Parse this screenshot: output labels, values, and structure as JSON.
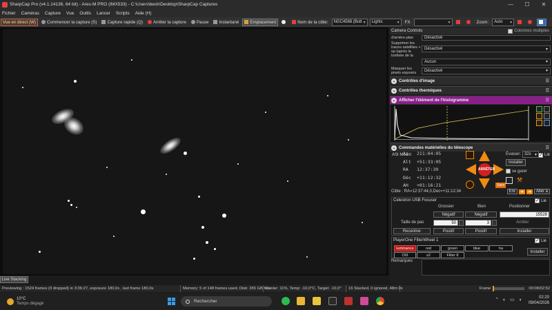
{
  "window": {
    "title": "SharpCap Pro (v4.1.14136, 64 bit) - Ares-M PRO (IMX533) - C:\\Users\\beck\\Desktop\\SharpCap Captures",
    "controls": {
      "minimize": "—",
      "maximize": "☐",
      "close": "✕"
    }
  },
  "menu": [
    "Fichier",
    "Caméras",
    "Capture",
    "Vue",
    "Outils",
    "Lancer",
    "Scripts",
    "Aide (H)"
  ],
  "toolbar": {
    "live_view": "Vue en direct (W)",
    "start_capture": "Commencer la capture (S)",
    "quick_capture": "Capture rapide (Q)",
    "stop_capture": "Arrêter la capture",
    "pause": "Pause",
    "snapshot": "Instantané",
    "placement": "Emplacement",
    "target_label": "Nom de la cible:",
    "target_value": "NGC4568 (Butt",
    "frame_type": "Lights",
    "fx_label": "FX",
    "fx_value": "",
    "zoom_label": "Zoom:",
    "zoom_value": "Auto"
  },
  "live_stacking_tab": "Live Stacking",
  "status": {
    "previewing": "Previewing : 1524 frames (0 dropped) in 3:36:27, exposure 180,0s , last frame 180,0s",
    "memory": "Memory: 5 of 148 frames used, Disk: 265 GB free",
    "cooler": "Cooler: 11%, Temp: -10,0°C, Target: -10,0°",
    "stack": "16 Stacked, 0 ignored, 48m 0s",
    "frame_label": "Frame",
    "time": "00:08/02:52"
  },
  "side": {
    "header_title": "Camera Controls",
    "header_checkbox": "Colonnes multiples",
    "controls": [
      {
        "label": "d'arrière-plan",
        "value": "Désactivé"
      },
      {
        "label": "Supprimer les traces satellites + sp (après la tombée de la nuit) sites",
        "value": "Désactivé"
      },
      {
        "label": "",
        "value": "Aucun"
      },
      {
        "label": "Masquer les pixels exposés",
        "value": "Désactivé"
      }
    ],
    "sections": {
      "image_controls": "Contrôles d'image",
      "thermal_controls": "Contrôles thermiques",
      "histogram": "Afficher l'élément de l'histogramme",
      "telescope": "Commandes matérielles du télescope"
    },
    "mount": {
      "name": "ASI Mount",
      "lie_label": "Lié",
      "coords": [
        {
          "k": "Az",
          "v": "211:04:05"
        },
        {
          "k": "Alt",
          "v": "+51:33:05"
        },
        {
          "k": "RA",
          "v": "12:37:39"
        },
        {
          "k": "Déc",
          "v": "+11:12:32"
        },
        {
          "k": "AH",
          "v": "+01:16:21"
        }
      ],
      "stop": "ARRÊTER",
      "follow": "Suivi",
      "evaluate_label": "Évaluer:",
      "evaluate_value": "32x",
      "install": "Installer",
      "park": "se garer",
      "target_line": "Cible : RA=12:37:44,0,Dec=+11:12:34",
      "enr": "Enr",
      "goto": "Aller à"
    },
    "focuser": {
      "name": "Celestron USB Focuser",
      "lie_label": "Lié",
      "col_coarse": "Grossier",
      "col_fine": "Bien",
      "col_position": "Positionner",
      "negative": "Négatif",
      "positive": "Positif",
      "position_value": "15528",
      "step_label": "Taille de pas",
      "coarse_step": "50",
      "fine_step": "3",
      "stop": "Arrêter",
      "recenter": "Recentrer",
      "install": "Installer"
    },
    "filterwheel": {
      "name": "PlayerOne FilterWheel 1",
      "lie_label": "Lié",
      "filters": [
        "luminance",
        "red",
        "green",
        "blue",
        "ha",
        "OIII",
        "s2",
        "Filter 8"
      ],
      "selected": "luminance",
      "install": "Installer"
    },
    "remarks_label": "Remarques"
  },
  "taskbar": {
    "temperature": "10°C",
    "weather": "Temps dégagé",
    "search": "Rechercher",
    "time": "02:20",
    "date": "09/04/2026"
  },
  "colors": {
    "accent_orange": "#f08a10",
    "histogram_header": "#8a1f8a",
    "filter_selected": "#b01818",
    "stop_red": "#d02020"
  }
}
